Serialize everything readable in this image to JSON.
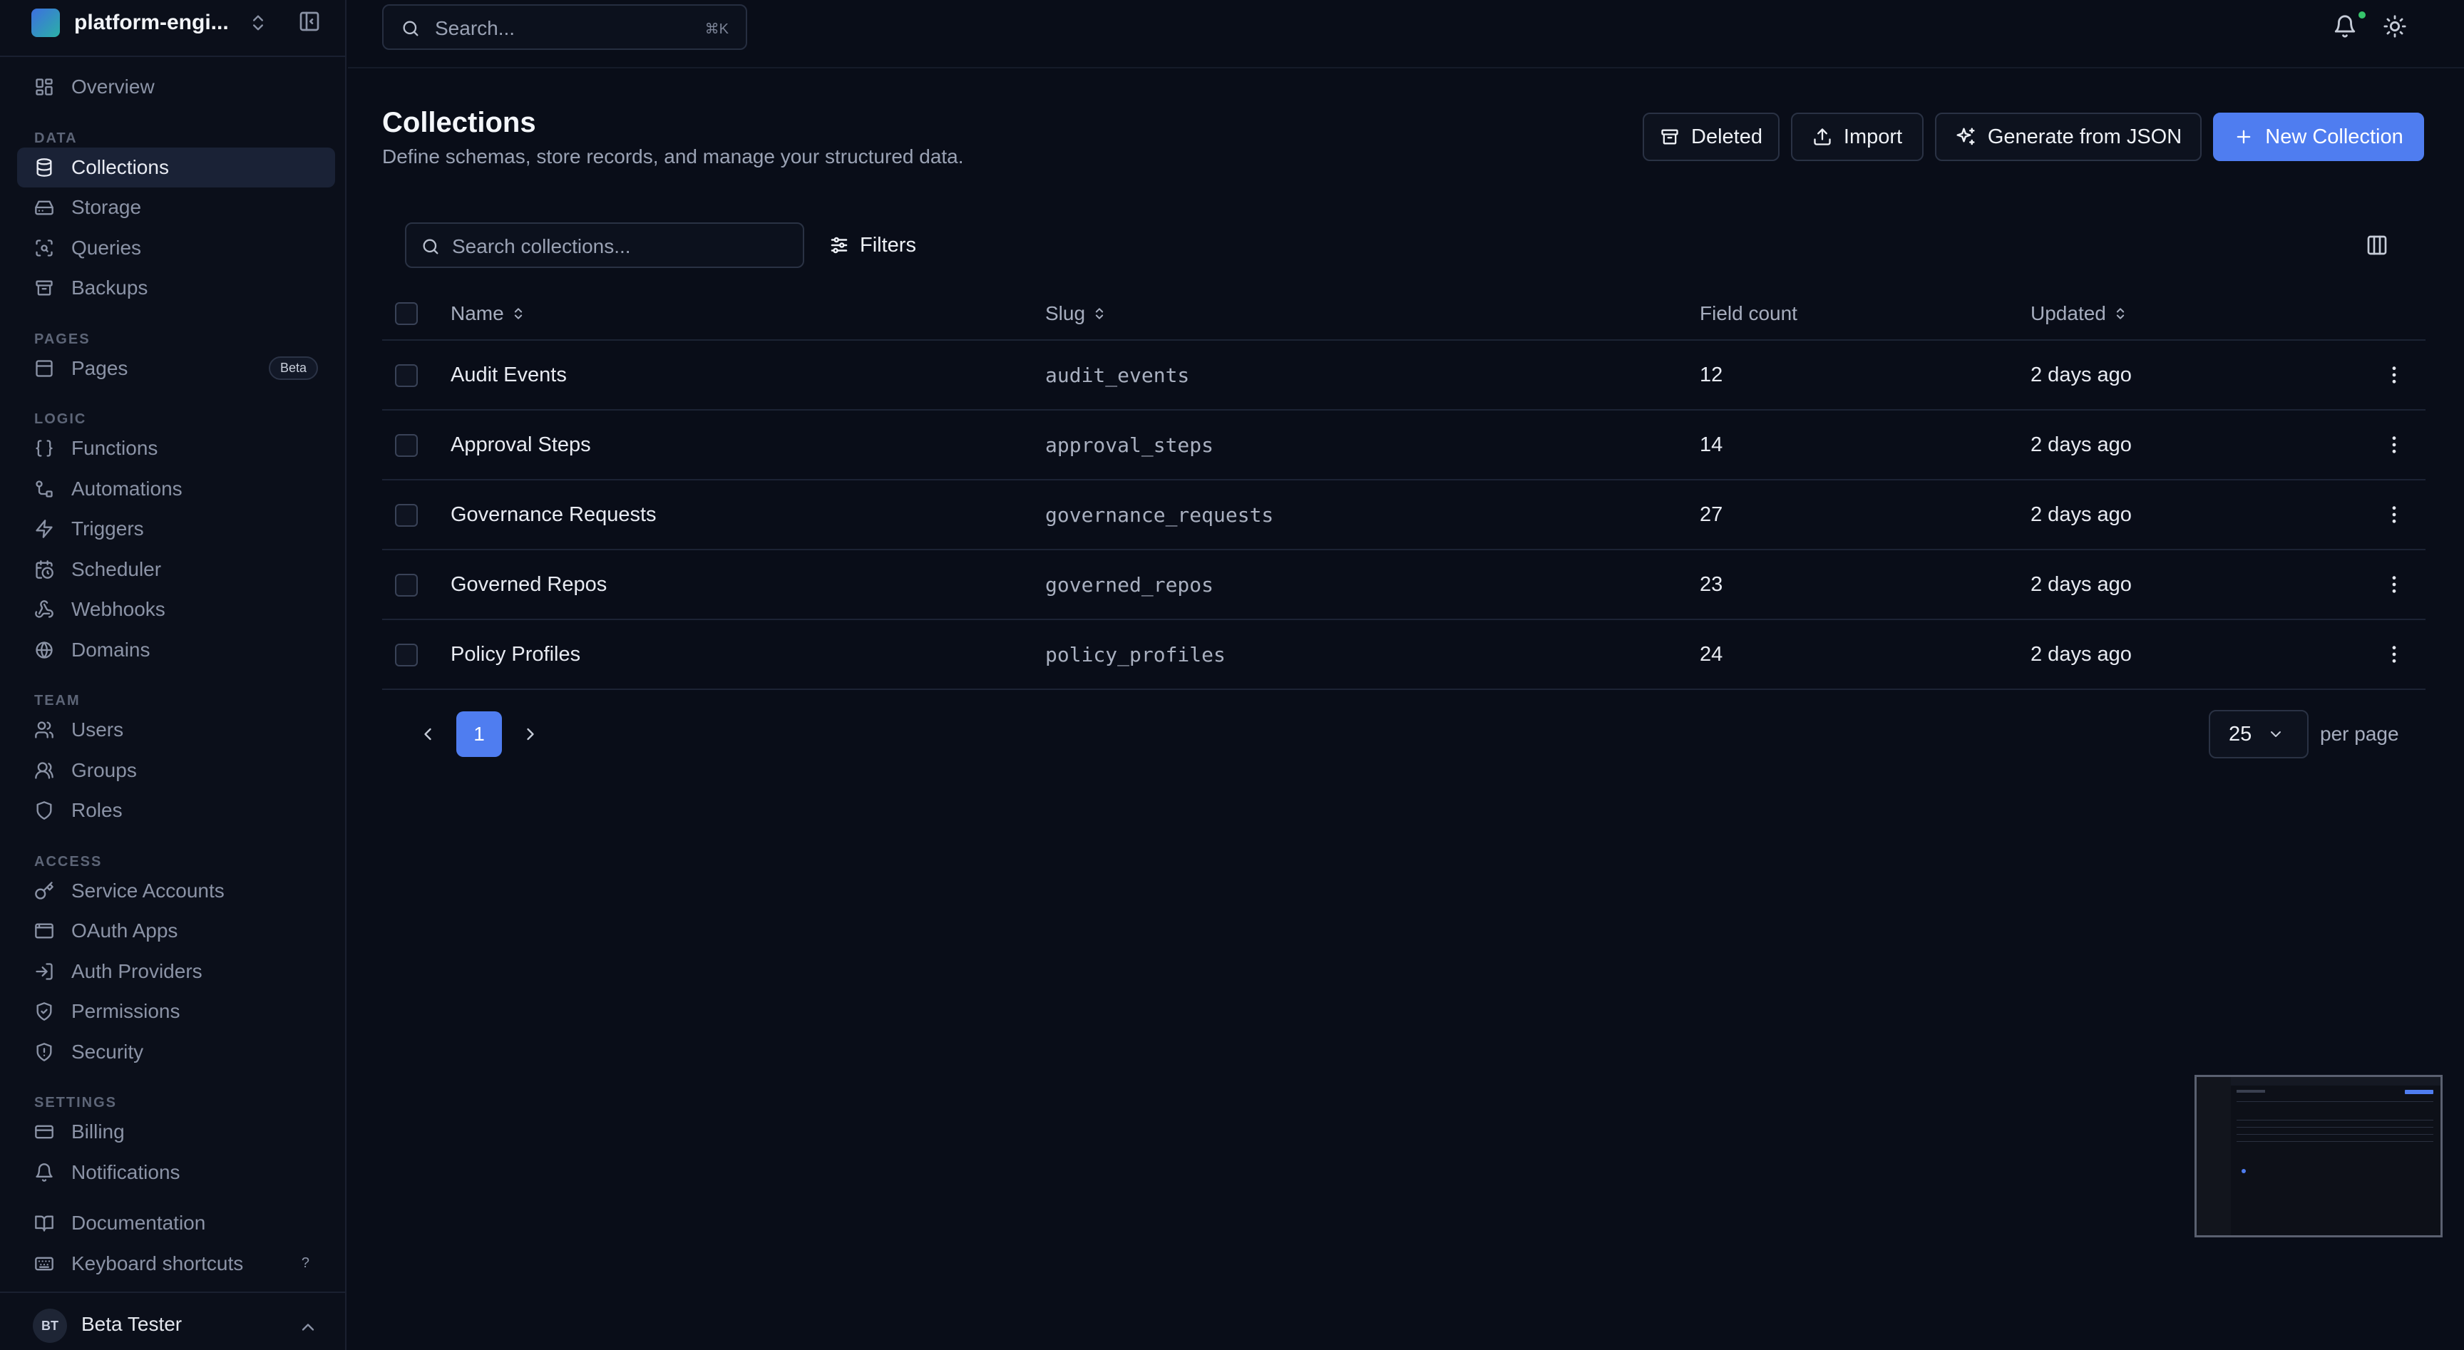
{
  "workspace": {
    "name": "platform-engi..."
  },
  "sidebar": {
    "sections": [
      {
        "title": "",
        "items": [
          {
            "label": "Overview",
            "icon": "dashboard-icon"
          }
        ]
      },
      {
        "title": "DATA",
        "items": [
          {
            "label": "Collections",
            "icon": "database-icon",
            "active": true
          },
          {
            "label": "Storage",
            "icon": "hard-drive-icon"
          },
          {
            "label": "Queries",
            "icon": "query-icon"
          },
          {
            "label": "Backups",
            "icon": "archive-icon"
          }
        ]
      },
      {
        "title": "PAGES",
        "items": [
          {
            "label": "Pages",
            "icon": "page-icon",
            "badge": "Beta"
          }
        ]
      },
      {
        "title": "LOGIC",
        "items": [
          {
            "label": "Functions",
            "icon": "braces-icon"
          },
          {
            "label": "Automations",
            "icon": "workflow-icon"
          },
          {
            "label": "Triggers",
            "icon": "lightning-icon"
          },
          {
            "label": "Scheduler",
            "icon": "calendar-clock-icon"
          },
          {
            "label": "Webhooks",
            "icon": "webhook-icon"
          },
          {
            "label": "Domains",
            "icon": "globe-icon"
          }
        ]
      },
      {
        "title": "TEAM",
        "items": [
          {
            "label": "Users",
            "icon": "users-icon"
          },
          {
            "label": "Groups",
            "icon": "group-icon"
          },
          {
            "label": "Roles",
            "icon": "shield-icon"
          }
        ]
      },
      {
        "title": "ACCESS",
        "items": [
          {
            "label": "Service Accounts",
            "icon": "key-icon"
          },
          {
            "label": "OAuth Apps",
            "icon": "app-window-icon"
          },
          {
            "label": "Auth Providers",
            "icon": "login-icon"
          },
          {
            "label": "Permissions",
            "icon": "shield-check-icon"
          },
          {
            "label": "Security",
            "icon": "shield-alert-icon"
          }
        ]
      },
      {
        "title": "SETTINGS",
        "items": [
          {
            "label": "Billing",
            "icon": "credit-card-icon"
          },
          {
            "label": "Notifications",
            "icon": "bell-icon"
          }
        ]
      }
    ],
    "footer_items": [
      {
        "label": "Documentation",
        "icon": "book-icon"
      },
      {
        "label": "Keyboard shortcuts",
        "icon": "keyboard-icon",
        "hint": "?"
      }
    ],
    "user": {
      "initials": "BT",
      "name": "Beta Tester"
    }
  },
  "topbar": {
    "search_placeholder": "Search...",
    "search_shortcut": "⌘K"
  },
  "page": {
    "title": "Collections",
    "subtitle": "Define schemas, store records, and manage your structured data.",
    "actions": {
      "deleted": "Deleted",
      "import": "Import",
      "generate": "Generate from JSON",
      "new": "New Collection"
    }
  },
  "toolbar": {
    "search_placeholder": "Search collections...",
    "filters": "Filters"
  },
  "table": {
    "columns": {
      "name": "Name",
      "slug": "Slug",
      "field_count": "Field count",
      "updated": "Updated"
    },
    "rows": [
      {
        "name": "Audit Events",
        "slug": "audit_events",
        "field_count": "12",
        "updated": "2 days ago"
      },
      {
        "name": "Approval Steps",
        "slug": "approval_steps",
        "field_count": "14",
        "updated": "2 days ago"
      },
      {
        "name": "Governance Requests",
        "slug": "governance_requests",
        "field_count": "27",
        "updated": "2 days ago"
      },
      {
        "name": "Governed Repos",
        "slug": "governed_repos",
        "field_count": "23",
        "updated": "2 days ago"
      },
      {
        "name": "Policy Profiles",
        "slug": "policy_profiles",
        "field_count": "24",
        "updated": "2 days ago"
      }
    ]
  },
  "pagination": {
    "current_page": "1",
    "per_page": "25",
    "per_page_label": "per page"
  },
  "colors": {
    "accent": "#4f7df0",
    "background": "#090d18",
    "status_dot": "#36c46b"
  }
}
